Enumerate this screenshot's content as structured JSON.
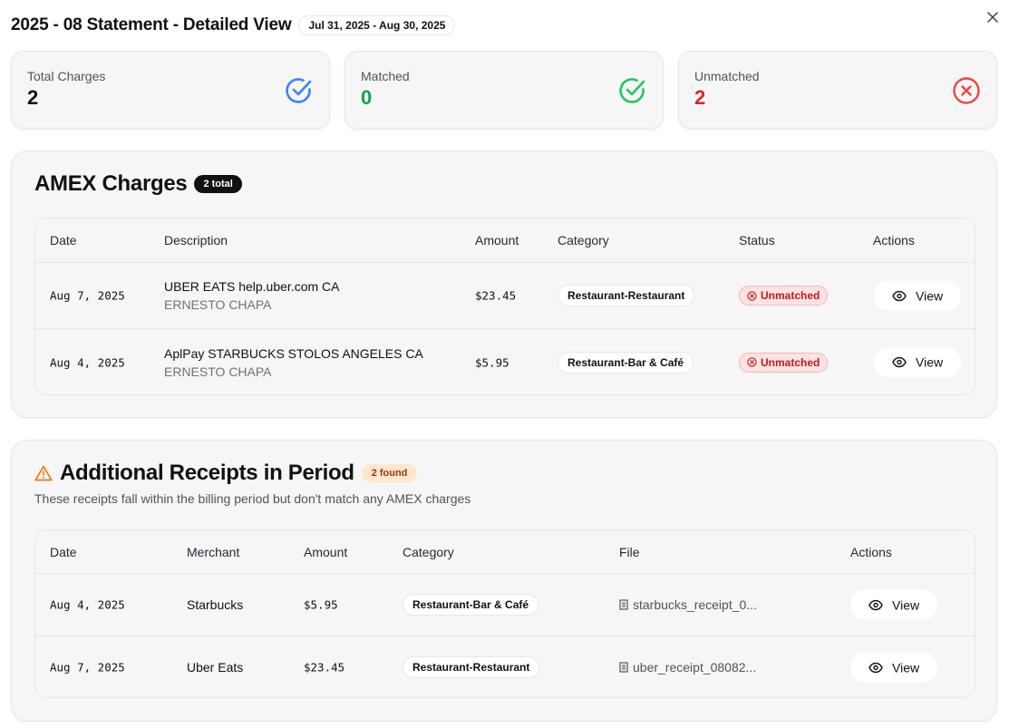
{
  "header": {
    "title": "2025 - 08 Statement - Detailed View",
    "date_range": "Jul 31, 2025 - Aug 30, 2025"
  },
  "stats": [
    {
      "label": "Total Charges",
      "value": "2",
      "color": "#111111",
      "icon": "check-circle-icon",
      "icon_color": "#3b82f6"
    },
    {
      "label": "Matched",
      "value": "0",
      "color": "#16a34a",
      "icon": "check-circle-icon",
      "icon_color": "#22c55e"
    },
    {
      "label": "Unmatched",
      "value": "2",
      "color": "#dc2626",
      "icon": "x-circle-icon",
      "icon_color": "#ef4444"
    }
  ],
  "amex": {
    "title": "AMEX Charges",
    "badge": "2 total",
    "columns": [
      "Date",
      "Description",
      "Amount",
      "Category",
      "Status",
      "Actions"
    ],
    "rows": [
      {
        "date": "Aug 7, 2025",
        "desc": "UBER EATS help.uber.com CA",
        "sub": "ERNESTO CHAPA",
        "amount": "$23.45",
        "category": "Restaurant-Restaurant",
        "status": "Unmatched",
        "action": "View"
      },
      {
        "date": "Aug 4, 2025",
        "desc": "AplPay STARBUCKS STOLOS ANGELES CA",
        "sub": "ERNESTO CHAPA",
        "amount": "$5.95",
        "category": "Restaurant-Bar & Café",
        "status": "Unmatched",
        "action": "View"
      }
    ]
  },
  "receipts": {
    "title": "Additional Receipts in Period",
    "badge": "2 found",
    "subtitle": "These receipts fall within the billing period but don't match any AMEX charges",
    "columns": [
      "Date",
      "Merchant",
      "Amount",
      "Category",
      "File",
      "Actions"
    ],
    "rows": [
      {
        "date": "Aug 4, 2025",
        "merchant": "Starbucks",
        "amount": "$5.95",
        "category": "Restaurant-Bar & Café",
        "file": "starbucks_receipt_0...",
        "action": "View"
      },
      {
        "date": "Aug 7, 2025",
        "merchant": "Uber Eats",
        "amount": "$23.45",
        "category": "Restaurant-Restaurant",
        "file": "uber_receipt_08082...",
        "action": "View"
      }
    ]
  }
}
